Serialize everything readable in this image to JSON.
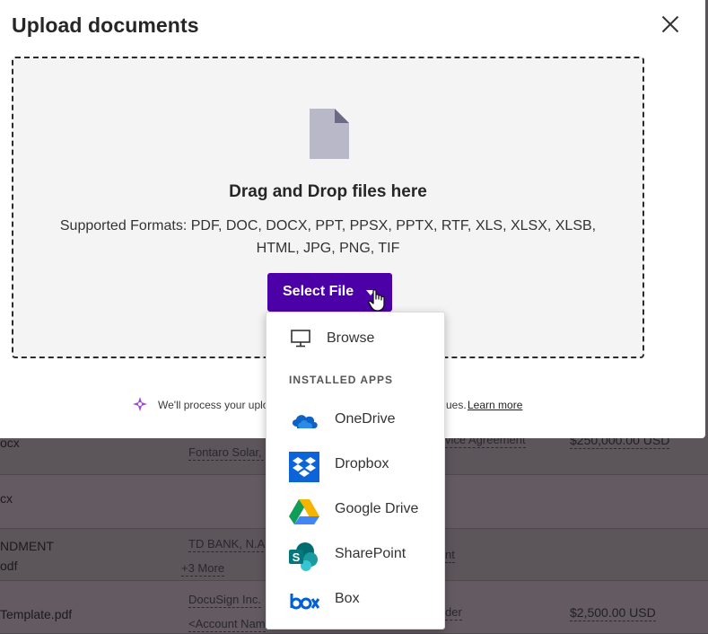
{
  "modal": {
    "title": "Upload documents",
    "close_label": "×"
  },
  "dropzone": {
    "title": "Drag and Drop files here",
    "formats_line1": "Supported Formats: PDF, DOC, DOCX, PPT, PPSX, PPTX, RTF, XLS, XLSX, XLSB,",
    "formats_line2": "HTML, JPG, PNG, TIF",
    "select_button": "Select File"
  },
  "notice": {
    "text_start": "We'll process your uplo",
    "text_end": "ues.",
    "learn_more": "Learn more"
  },
  "menu": {
    "browse": "Browse",
    "section_label": "INSTALLED APPS",
    "apps": [
      {
        "label": "OneDrive",
        "icon": "onedrive-icon"
      },
      {
        "label": "Dropbox",
        "icon": "dropbox-icon"
      },
      {
        "label": "Google Drive",
        "icon": "google-drive-icon"
      },
      {
        "label": "SharePoint",
        "icon": "sharepoint-icon"
      },
      {
        "label": "Box",
        "icon": "box-icon"
      }
    ]
  },
  "background_table": {
    "rows": [
      {
        "name": "ocx",
        "party": "Fontaro Solar, I",
        "type": "vice Agreement",
        "amount": "$250,000.00 USD"
      },
      {
        "name": "cx"
      },
      {
        "name_line1": "NDMENT",
        "name_line2": "odf",
        "party": "TD BANK, N.A.",
        "more": "+3 More",
        "type": "nt"
      },
      {
        "name": "Template.pdf",
        "party": "DocuSign Inc.",
        "party2": "<Account Nam",
        "type": "der",
        "amount": "$2,500.00 USD"
      }
    ]
  },
  "colors": {
    "primary": "#4c00a8",
    "overlay": "#5a5358",
    "dropzone_bg": "#f4f4f5"
  }
}
